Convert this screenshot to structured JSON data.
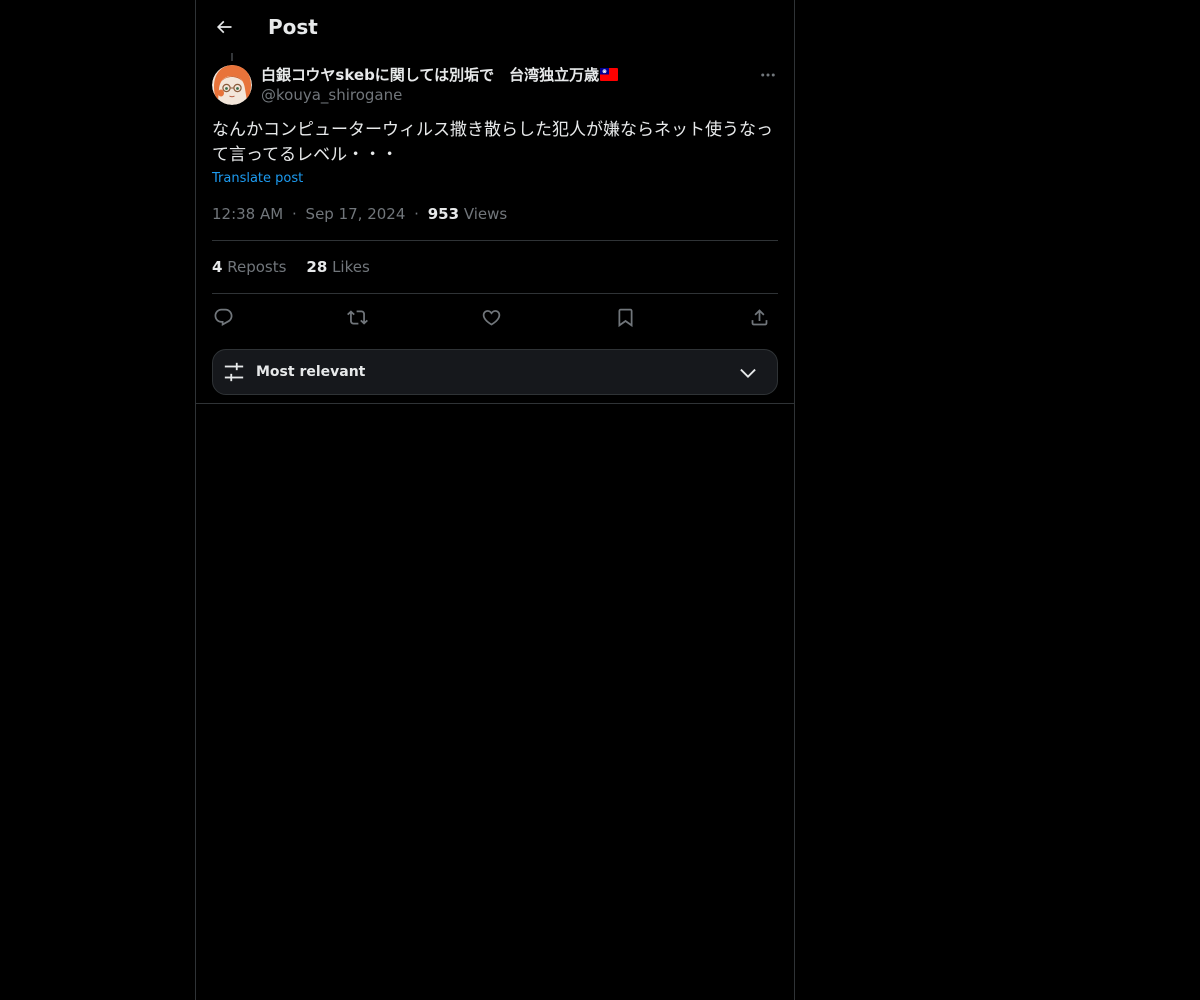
{
  "header": {
    "title": "Post",
    "back_icon": "arrow-left-icon"
  },
  "post": {
    "author": {
      "display_name": "白銀コウヤskebに関しては別垢で　台湾独立万歳",
      "flag_icon": "taiwan-flag-icon",
      "handle": "@kouya_shirogane",
      "avatar_icon": "anime-girl-avatar"
    },
    "more_icon": "more-horizontal-icon",
    "text": "なんかコンピューターウィルス撒き散らした犯人が嫌ならネット使うなって言ってるレベル・・・",
    "translate_label": "Translate post",
    "time": "12:38 AM",
    "separator": "·",
    "date": "Sep 17, 2024",
    "views_count": "953",
    "views_label": "Views",
    "reposts_count": "4",
    "reposts_label": "Reposts",
    "likes_count": "28",
    "likes_label": "Likes"
  },
  "actions": [
    {
      "name": "reply",
      "icon": "reply-icon"
    },
    {
      "name": "repost",
      "icon": "repost-icon"
    },
    {
      "name": "like",
      "icon": "heart-icon"
    },
    {
      "name": "bookmark",
      "icon": "bookmark-icon"
    },
    {
      "name": "share",
      "icon": "share-icon"
    }
  ],
  "sort": {
    "label": "Most relevant",
    "icon": "sliders-icon",
    "chevron": "chevron-down-icon"
  },
  "colors": {
    "background": "#000000",
    "text": "#e7e9ea",
    "muted": "#71767b",
    "accent": "#1d9bf0",
    "border": "#2f3336",
    "sort_bg": "#16181c"
  }
}
